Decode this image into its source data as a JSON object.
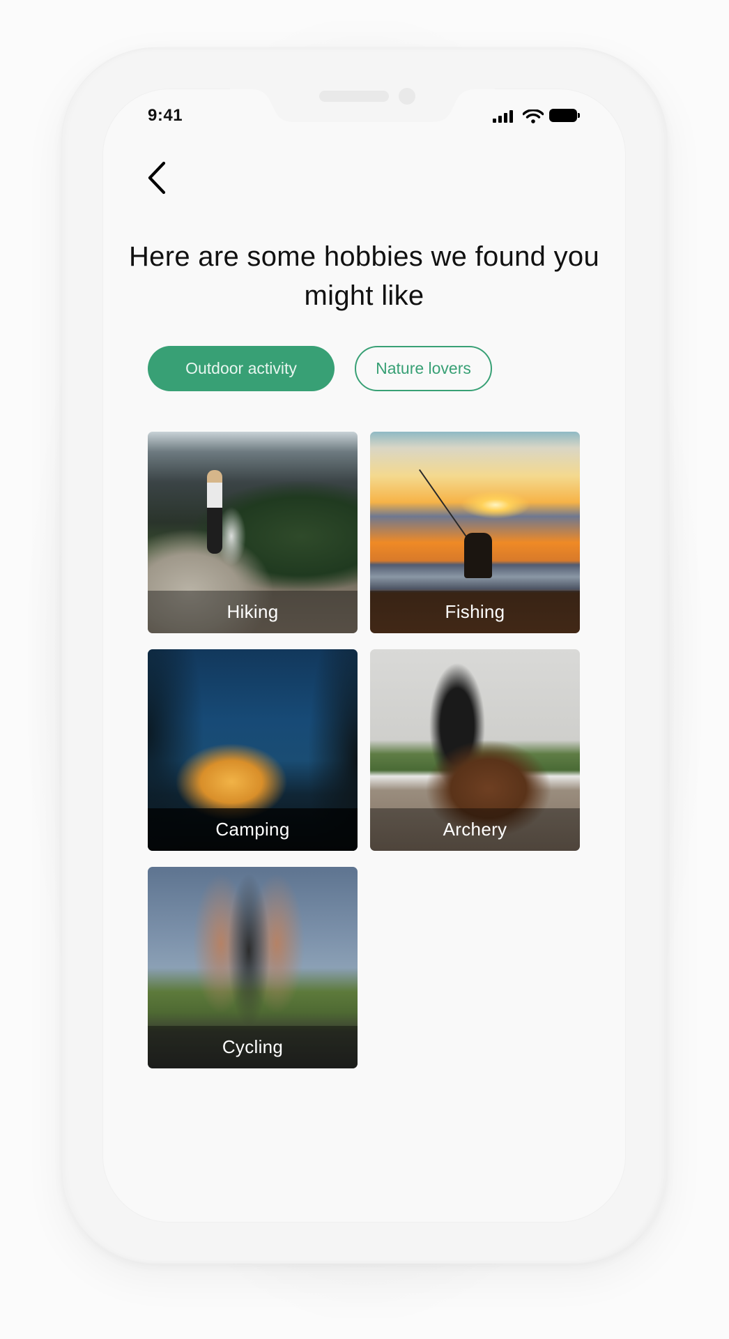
{
  "status_bar": {
    "time": "9:41",
    "icons": [
      "cellular-signal-icon",
      "wifi-icon",
      "battery-icon"
    ]
  },
  "header": {
    "back_icon": "chevron-left-icon",
    "title": "Here are some hobbies we found you might like"
  },
  "filters": [
    {
      "label": "Outdoor activity",
      "selected": true
    },
    {
      "label": "Nature lovers",
      "selected": false
    }
  ],
  "hobbies": [
    {
      "label": "Hiking"
    },
    {
      "label": "Fishing"
    },
    {
      "label": "Camping"
    },
    {
      "label": "Archery"
    },
    {
      "label": "Cycling"
    }
  ],
  "colors": {
    "accent": "#38A075",
    "background": "#F9F9F9",
    "text": "#111111"
  }
}
